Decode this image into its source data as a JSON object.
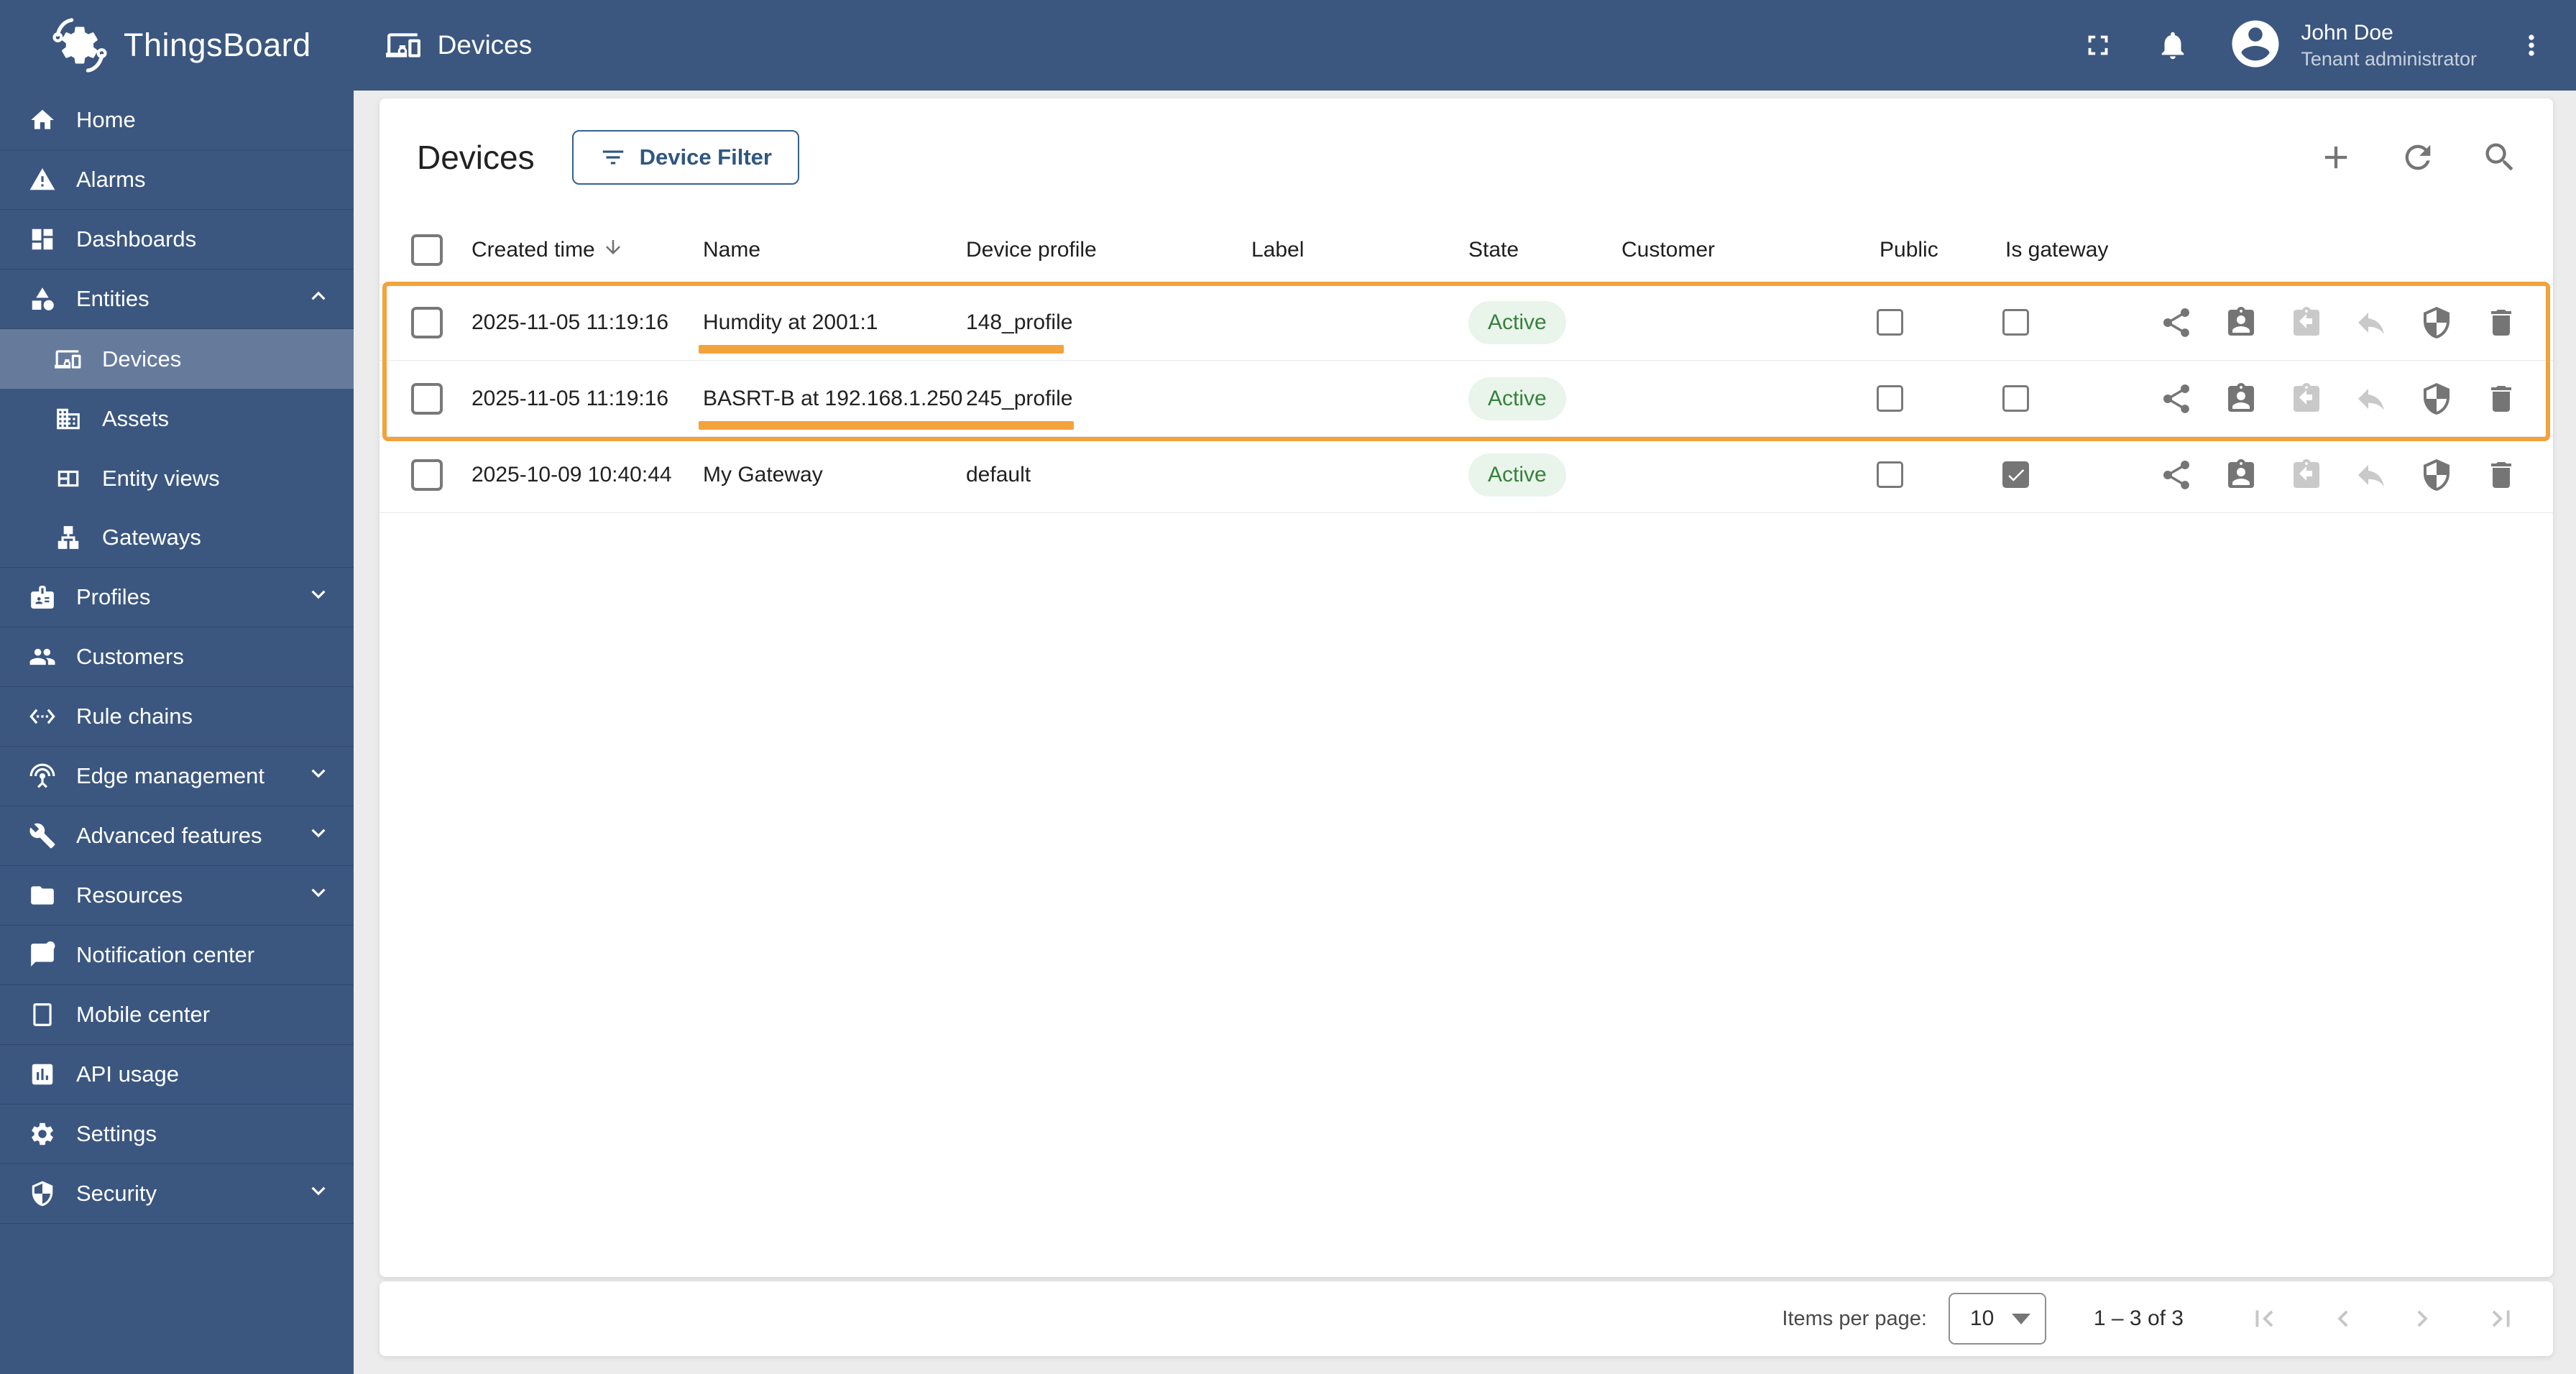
{
  "header": {
    "app_name": "ThingsBoard",
    "page_title": "Devices",
    "user": {
      "name": "John Doe",
      "role": "Tenant administrator"
    }
  },
  "sidebar": {
    "items": [
      {
        "label": "Home"
      },
      {
        "label": "Alarms"
      },
      {
        "label": "Dashboards"
      },
      {
        "label": "Entities",
        "expanded": true
      },
      {
        "label": "Devices",
        "sub": true,
        "active": true
      },
      {
        "label": "Assets",
        "sub": true
      },
      {
        "label": "Entity views",
        "sub": true
      },
      {
        "label": "Gateways",
        "sub": true
      },
      {
        "label": "Profiles",
        "collapsible": true
      },
      {
        "label": "Customers"
      },
      {
        "label": "Rule chains"
      },
      {
        "label": "Edge management",
        "collapsible": true
      },
      {
        "label": "Advanced features",
        "collapsible": true
      },
      {
        "label": "Resources",
        "collapsible": true
      },
      {
        "label": "Notification center"
      },
      {
        "label": "Mobile center"
      },
      {
        "label": "API usage"
      },
      {
        "label": "Settings"
      },
      {
        "label": "Security",
        "collapsible": true
      }
    ]
  },
  "main": {
    "title": "Devices",
    "filter_button": "Device Filter",
    "table": {
      "columns": [
        "Created time",
        "Name",
        "Device profile",
        "Label",
        "State",
        "Customer",
        "Public",
        "Is gateway"
      ],
      "rows": [
        {
          "created_time": "2025-11-05 11:19:16",
          "name": "Humdity at 2001:1",
          "device_profile": "148_profile",
          "label": "",
          "state": "Active",
          "customer": "",
          "public": false,
          "is_gateway": false,
          "highlighted": true
        },
        {
          "created_time": "2025-11-05 11:19:16",
          "name": "BASRT-B at 192.168.1.250",
          "device_profile": "245_profile",
          "label": "",
          "state": "Active",
          "customer": "",
          "public": false,
          "is_gateway": false,
          "highlighted": true
        },
        {
          "created_time": "2025-10-09 10:40:44",
          "name": "My Gateway",
          "device_profile": "default",
          "label": "",
          "state": "Active",
          "customer": "",
          "public": false,
          "is_gateway": true,
          "highlighted": false
        }
      ]
    },
    "pagination": {
      "items_per_page_label": "Items per page:",
      "items_per_page_value": "10",
      "range_label": "1 – 3 of 3"
    }
  },
  "colors": {
    "primary": "#3B5780",
    "accent_button_text": "#305680",
    "annotation_orange": "#F2A33C",
    "state_active_bg": "#E9F4EA",
    "state_active_text": "#38803F"
  },
  "icons": {
    "top": [
      "fullscreen-icon",
      "notifications-bell-icon",
      "account-circle-icon",
      "more-vert-icon"
    ],
    "card": [
      "add-icon",
      "refresh-icon",
      "search-icon",
      "filter-icon"
    ],
    "row_actions": [
      "share-icon",
      "assign-to-customer-icon",
      "unassign-from-customer-icon",
      "revert-icon",
      "manage-credentials-shield-icon",
      "delete-icon"
    ],
    "pager": [
      "first-page-icon",
      "prev-page-icon",
      "next-page-icon",
      "last-page-icon"
    ]
  }
}
